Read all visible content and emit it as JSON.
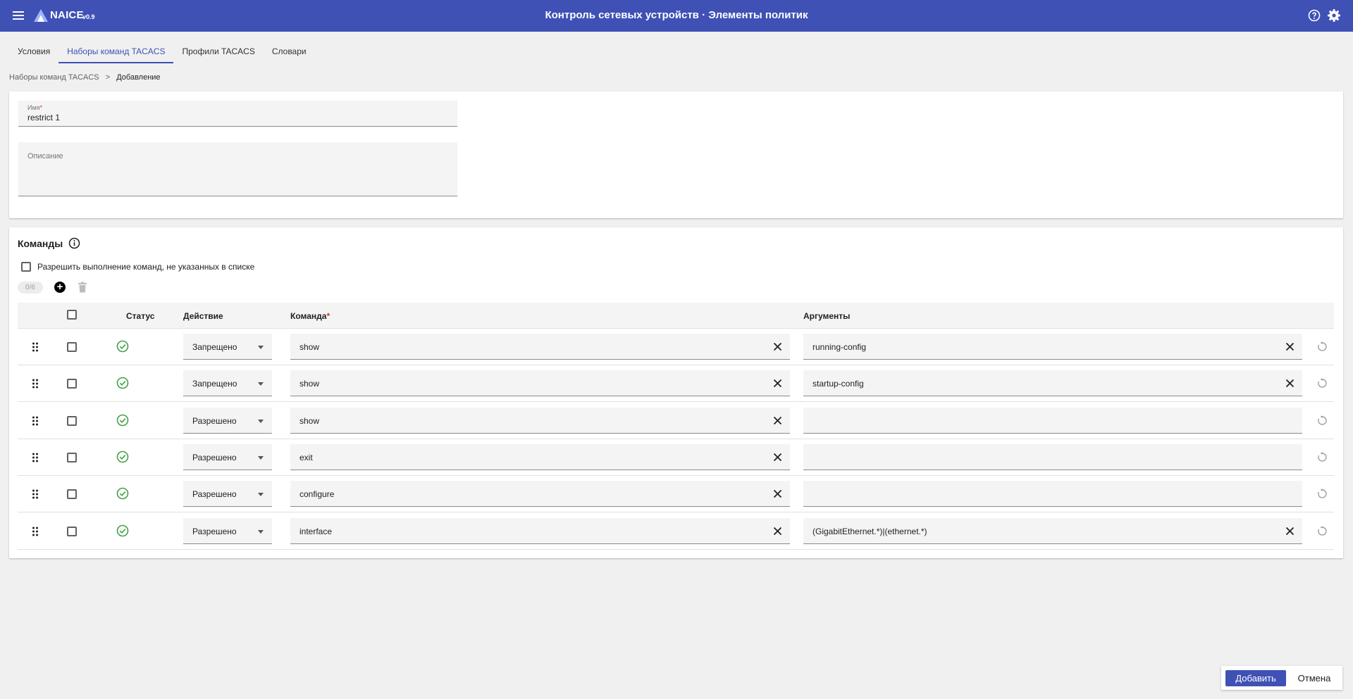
{
  "app": {
    "name": "NAICE",
    "version": "v0.9",
    "title": "Контроль сетевых устройств · Элементы политик"
  },
  "tabs": [
    {
      "label": "Условия",
      "active": false
    },
    {
      "label": "Наборы команд TACACS",
      "active": true
    },
    {
      "label": "Профили TACACS",
      "active": false
    },
    {
      "label": "Словари",
      "active": false
    }
  ],
  "breadcrumb": {
    "parent": "Наборы команд TACACS",
    "separator": ">",
    "current": "Добавление"
  },
  "form": {
    "name": {
      "label": "Имя",
      "required_mark": "*",
      "value": "restrict 1"
    },
    "description": {
      "label": "Описание",
      "value": ""
    }
  },
  "commands": {
    "title": "Команды",
    "allow_unlisted_label": "Разрешить выполнение команд, не указанных в списке",
    "allow_unlisted_checked": false,
    "selection_counter": "0/6",
    "columns": {
      "status": "Статус",
      "action": "Действие",
      "command": "Команда",
      "command_required_mark": "*",
      "arguments": "Аргументы"
    },
    "rows": [
      {
        "status": "ok",
        "action": "Запрещено",
        "command": "show",
        "arguments": "running-config"
      },
      {
        "status": "ok",
        "action": "Запрещено",
        "command": "show",
        "arguments": "startup-config"
      },
      {
        "status": "ok",
        "action": "Разрешено",
        "command": "show",
        "arguments": ""
      },
      {
        "status": "ok",
        "action": "Разрешено",
        "command": "exit",
        "arguments": ""
      },
      {
        "status": "ok",
        "action": "Разрешено",
        "command": "configure",
        "arguments": ""
      },
      {
        "status": "ok",
        "action": "Разрешено",
        "command": "interface",
        "arguments": "(GigabitEthernet.*)|(ethernet.*)"
      }
    ]
  },
  "footer": {
    "submit_label": "Добавить",
    "cancel_label": "Отмена"
  },
  "colors": {
    "primary": "#3f51b5",
    "success": "#43a047",
    "required": "#d32f2f"
  }
}
